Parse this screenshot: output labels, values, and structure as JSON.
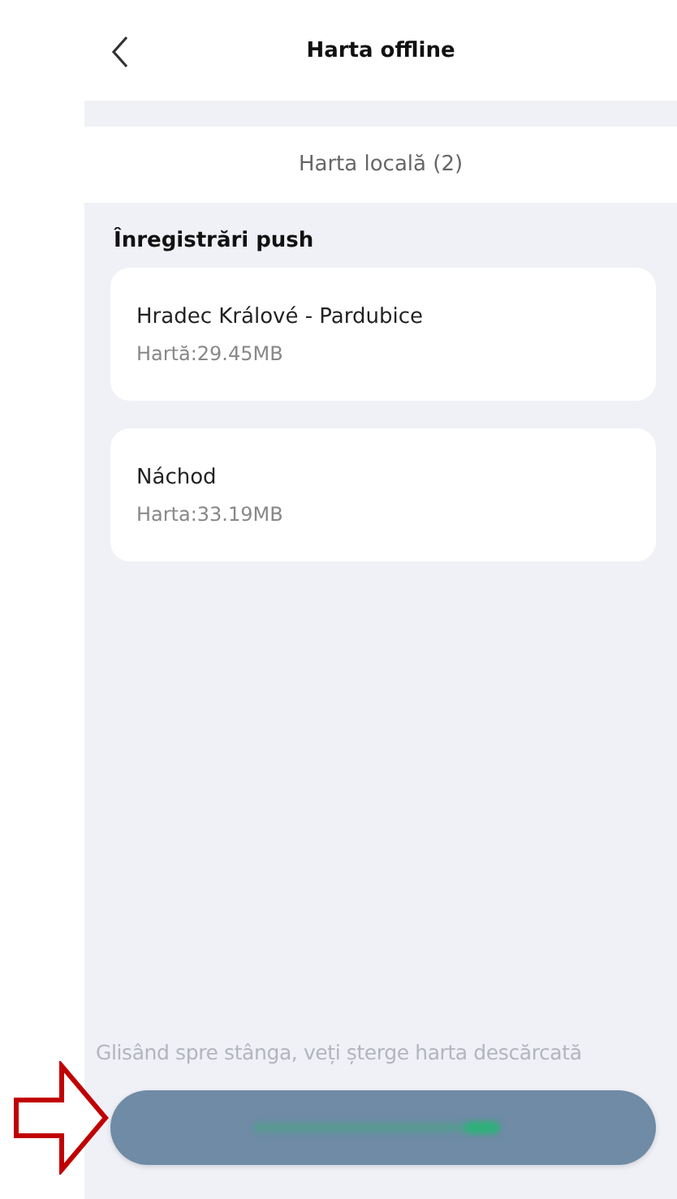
{
  "header": {
    "title": "Harta offline"
  },
  "tab": {
    "label": "Harta locală (2)"
  },
  "section": {
    "title": "Înregistrări push"
  },
  "maps": [
    {
      "name": "Hradec Králové - Pardubice",
      "size": "Hartă:29.45MB"
    },
    {
      "name": "Náchod",
      "size": "Harta:33.19MB"
    }
  ],
  "hint": "Glisând spre stânga, veți șterge harta descărcată"
}
